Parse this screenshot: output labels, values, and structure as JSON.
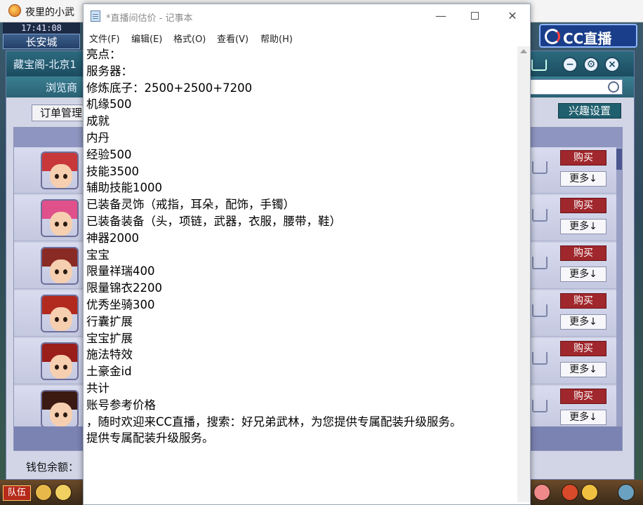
{
  "game": {
    "window_title": "夜里的小武",
    "hud_time": "17:41:08",
    "hud_city": "长安城",
    "cc_logo_text": "CC直播",
    "team_button": "队伍"
  },
  "shop": {
    "title": "藏宝阁-北京1",
    "browse_label": "浏览商",
    "order_button": "订单管理",
    "interest_button": "兴趣设置",
    "wallet_label": "钱包余额：",
    "rows": [
      {
        "buy": "购买",
        "more": "更多↓",
        "hair_color": "#c8383a"
      },
      {
        "buy": "购买",
        "more": "更多↓",
        "hair_color": "#e0508a"
      },
      {
        "buy": "购买",
        "more": "更多↓",
        "hair_color": "#8a2a24"
      },
      {
        "buy": "购买",
        "more": "更多↓",
        "hair_color": "#b22a1e"
      },
      {
        "buy": "购买",
        "more": "更多↓",
        "hair_color": "#9a1e1a"
      },
      {
        "buy": "购买",
        "more": "更多↓",
        "hair_color": "#3a1a12"
      }
    ]
  },
  "notepad": {
    "title": "*直播间估价 - 记事本",
    "menu": [
      "文件(F)",
      "编辑(E)",
      "格式(O)",
      "查看(V)",
      "帮助(H)"
    ],
    "lines": [
      "亮点：",
      "服务器：",
      "修炼底子：2500+2500+7200",
      "机缘500",
      "成就",
      "内丹",
      "经验500",
      "技能3500",
      "辅助技能1000",
      "已装备灵饰（戒指，耳朵，配饰，手镯）",
      "已装备装备（头，项链，武器，衣服，腰带，鞋）",
      "神器2000",
      "宝宝",
      "限量祥瑞400",
      "限量锦衣2200",
      "优秀坐骑300",
      "行囊扩展",
      "宝宝扩展",
      "施法特效",
      "土豪金id",
      "共计",
      "账号参考价格",
      "，随时欢迎来CC直播，搜索：好兄弟武林，为您提供专属配装升级服务。",
      "提供专属配装升级服务。"
    ]
  }
}
